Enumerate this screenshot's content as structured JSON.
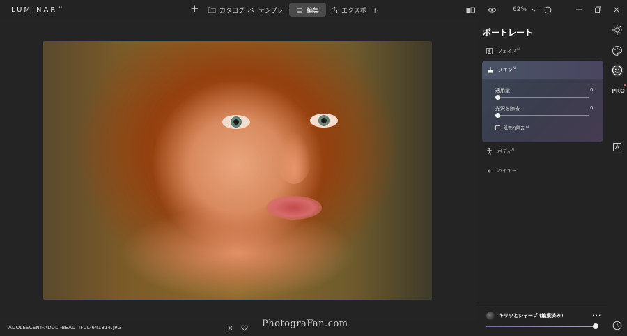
{
  "app": {
    "logo_text": "LUMINAR",
    "logo_sup": "AI"
  },
  "topnav": {
    "items": [
      {
        "label": "カタログ",
        "icon": "folder-icon"
      },
      {
        "label": "テンプレート",
        "icon": "templates-icon"
      },
      {
        "label": "編集",
        "icon": "edit-sliders-icon"
      },
      {
        "label": "エクスポート",
        "icon": "export-icon"
      }
    ],
    "active": "編集",
    "zoom_label": "62%"
  },
  "canvas": {
    "filename": "ADOLESCENT-ADULT-BEAUTIFUL-641314.JPG",
    "watermark": "PhotograFan.com"
  },
  "panel": {
    "title": "ポートレート",
    "tools": [
      {
        "label": "フェイス",
        "badge": "AI",
        "icon": "face-icon"
      },
      {
        "label": "ボディ",
        "badge": "AI",
        "icon": "body-icon"
      },
      {
        "label": "ハイキー",
        "badge": "",
        "icon": "high-key-icon"
      }
    ],
    "skin": {
      "label": "スキン",
      "badge": "AI",
      "sliders": [
        {
          "label": "適用量",
          "value": "0",
          "level": 0
        },
        {
          "label": "光沢を除去",
          "value": "0",
          "level": 0
        }
      ],
      "checkbox_label": "肌荒れ除去",
      "checkbox_badge": "AI",
      "checkbox_checked": false
    },
    "preset": {
      "label": "キリッとシャープ (編集済み)",
      "more": "···",
      "level": 1.0
    }
  },
  "strip": {
    "pro_label": "PRO"
  },
  "colors": {
    "accent": "#7c6aa8",
    "panel_card": "#3c4656",
    "bg": "#232323"
  }
}
